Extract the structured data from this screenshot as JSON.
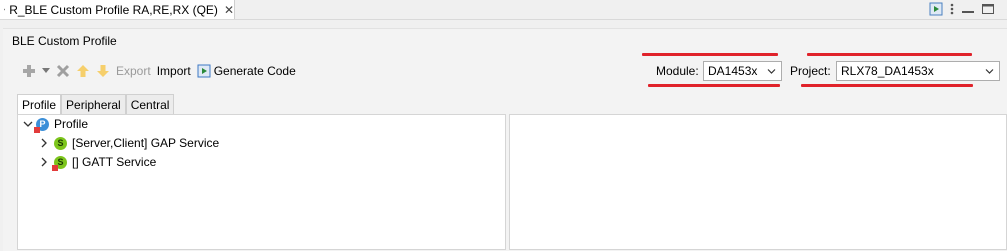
{
  "editor_tab": {
    "title": "R_BLE Custom Profile RA,RE,RX (QE)",
    "close_glyph": "✕"
  },
  "panel": {
    "title": "BLE Custom Profile"
  },
  "toolbar": {
    "export_label": "Export",
    "import_label": "Import",
    "generate_label": "Generate Code"
  },
  "module": {
    "label": "Module:",
    "value": "DA1453x"
  },
  "project": {
    "label": "Project:",
    "value": "RLX78_DA1453x"
  },
  "view_tabs": [
    "Profile",
    "Peripheral",
    "Central"
  ],
  "tree": {
    "root": {
      "label": "Profile",
      "badge": "P"
    },
    "children": [
      {
        "label": "[Server,Client] GAP Service",
        "badge": "S"
      },
      {
        "label": "[] GATT Service",
        "badge": "S"
      }
    ]
  },
  "colors": {
    "annotation_red": "#e0222a",
    "service_green": "#7cc51c",
    "profile_blue": "#3c8fd8"
  }
}
